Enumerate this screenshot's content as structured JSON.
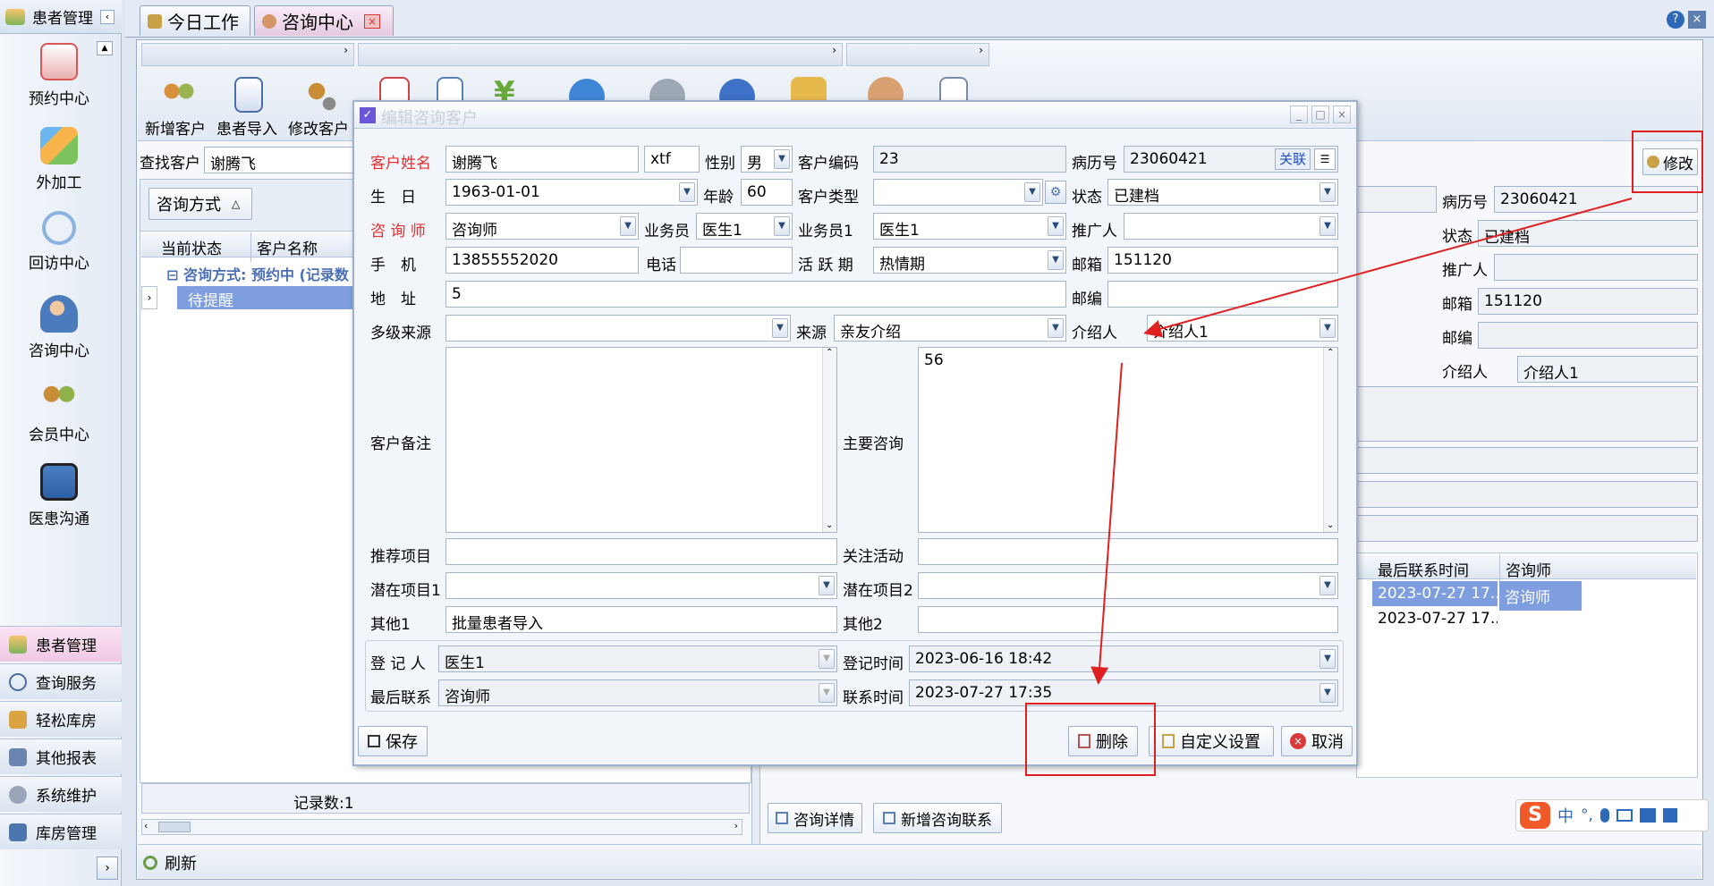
{
  "nav": {
    "header": "患者管理",
    "big_items": [
      {
        "label": "预约中心",
        "icon": "calendar-icon"
      },
      {
        "label": "外加工",
        "icon": "cubes-icon"
      },
      {
        "label": "回访中心",
        "icon": "refresh-icon"
      },
      {
        "label": "咨询中心",
        "icon": "consult-icon"
      },
      {
        "label": "会员中心",
        "icon": "members-icon"
      },
      {
        "label": "医患沟通",
        "icon": "video-icon"
      }
    ],
    "bottom_items": [
      {
        "label": "患者管理",
        "icon": "users-icon"
      },
      {
        "label": "查询服务",
        "icon": "search-icon"
      },
      {
        "label": "轻松库房",
        "icon": "box-icon"
      },
      {
        "label": "其他报表",
        "icon": "report-icon"
      },
      {
        "label": "系统维护",
        "icon": "gears-icon"
      },
      {
        "label": "库房管理",
        "icon": "warehouse-icon"
      }
    ]
  },
  "tabs": [
    {
      "label": "今日工作"
    },
    {
      "label": "咨询中心"
    }
  ],
  "ribbon": {
    "buttons": [
      "新增客户",
      "患者导入",
      "修改客户"
    ]
  },
  "search": {
    "label": "查找客户",
    "value": "谢腾飞"
  },
  "grouping": {
    "label": "咨询方式"
  },
  "grid": {
    "columns": [
      "当前状态",
      "客户名称"
    ],
    "group_row": "咨询方式: 预约中 (记录数",
    "rows": [
      {
        "status": "待提醒"
      }
    ],
    "footer": "记录数:1"
  },
  "refresh_label": "刷新",
  "right_panel": {
    "edit_button": "修改",
    "fields": {
      "record_no_label": "病历号",
      "record_no": "23060421",
      "status_label": "状态",
      "status": "已建档",
      "promoter_label": "推广人",
      "email_label": "邮箱",
      "email": "151120",
      "zip_label": "邮编",
      "referrer_label": "介绍人",
      "referrer": "介绍人1"
    },
    "table": {
      "columns": [
        "最后联系时间",
        "咨询师"
      ],
      "rows": [
        {
          "time": "2023-07-27 17...",
          "consultant": "咨询师"
        },
        {
          "time": "2023-07-27 17...",
          "consultant": ""
        }
      ]
    },
    "bottom_buttons": [
      "咨询详情",
      "新增咨询联系"
    ]
  },
  "dialog": {
    "title": "编辑咨询客户",
    "labels": {
      "name": "客户姓名",
      "gender": "性别",
      "code": "客户编码",
      "record_no": "病历号",
      "birthday": "生　日",
      "age": "年龄",
      "type": "客户类型",
      "status": "状态",
      "consultant": "咨 询 师",
      "salesman": "业务员",
      "salesman1": "业务员1",
      "promoter": "推广人",
      "mobile": "手　机",
      "phone": "电话",
      "active": "活 跃 期",
      "email": "邮箱",
      "address": "地　址",
      "zip": "邮编",
      "multi_source": "多级来源",
      "source": "来源",
      "referrer": "介绍人",
      "remark": "客户备注",
      "main_consult": "主要咨询",
      "recommend": "推荐项目",
      "activity": "关注活动",
      "potential1": "潜在项目1",
      "potential2": "潜在项目2",
      "other1": "其他1",
      "other2": "其他2",
      "registrar": "登 记 人",
      "reg_time": "登记时间",
      "last_contact": "最后联系",
      "contact_time": "联系时间"
    },
    "values": {
      "name": "谢腾飞",
      "pinyin": "xtf",
      "gender": "男",
      "code": "23",
      "record_no": "23060421",
      "link": "关联",
      "birthday": "1963-01-01",
      "age": "60",
      "type": "",
      "status": "已建档",
      "consultant": "咨询师",
      "salesman": "医生1",
      "salesman1": "医生1",
      "promoter": "",
      "mobile": "13855552020",
      "phone": "",
      "active": "热情期",
      "email": "151120",
      "address": "5",
      "zip": "",
      "multi_source": "",
      "source": "亲友介绍",
      "referrer": "介绍人1",
      "remark": "",
      "main_consult": "56",
      "recommend": "",
      "activity": "",
      "potential1": "",
      "potential2": "",
      "other1": "批量患者导入",
      "other2": "",
      "registrar": "医生1",
      "reg_time": "2023-06-16 18:42",
      "last_contact": "咨询师",
      "contact_time": "2023-07-27 17:35"
    },
    "buttons": {
      "save": "保存",
      "delete": "删除",
      "custom": "自定义设置",
      "cancel": "取消"
    }
  },
  "ime_bar": {
    "text": "中"
  },
  "colors": {
    "annotation": "#e02020",
    "selected_row": "#7e9ee0"
  }
}
